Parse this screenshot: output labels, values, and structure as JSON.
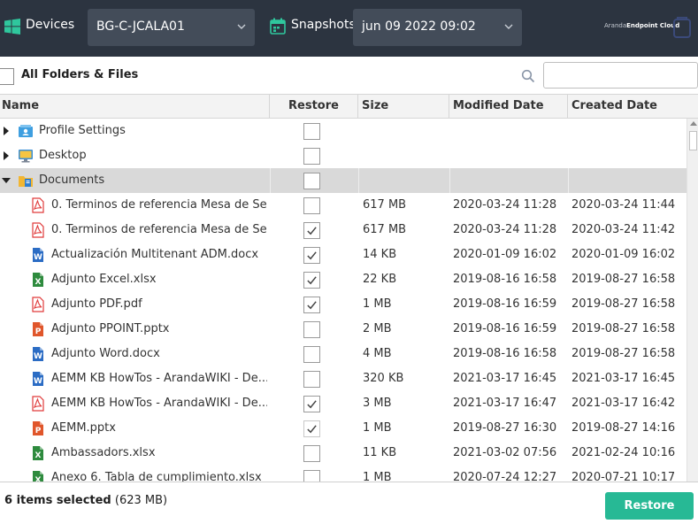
{
  "topbar": {
    "devices_label": "Devices",
    "device_value": "BG-C-JCALA01",
    "snapshots_label": "Snapshots",
    "snapshot_value": "jun 09 2022 09:02",
    "brand_prefix": "Aranda",
    "brand_name": "Endpoint Cloud"
  },
  "toolbar": {
    "all_label": "All Folders & Files",
    "search_value": ""
  },
  "table": {
    "columns": [
      "Name",
      "Restore",
      "Size",
      "Modified Date",
      "Created Date"
    ],
    "rows": [
      {
        "name": "Profile Settings",
        "icon": "profile-icon",
        "type": "folder",
        "expanded": false,
        "selected": false,
        "restore": false,
        "size": "",
        "modified": "",
        "created": ""
      },
      {
        "name": "Desktop",
        "icon": "desktop-icon",
        "type": "folder",
        "expanded": false,
        "selected": false,
        "restore": false,
        "size": "",
        "modified": "",
        "created": ""
      },
      {
        "name": "Documents",
        "icon": "documents-folder-icon",
        "type": "folder",
        "expanded": true,
        "selected": true,
        "restore": false,
        "size": "",
        "modified": "",
        "created": ""
      },
      {
        "name": "0. Terminos de referencia Mesa de Se...",
        "icon": "pdf-icon",
        "type": "file",
        "restore": false,
        "size": "617 MB",
        "modified": "2020-03-24 11:28",
        "created": "2020-03-24 11:44"
      },
      {
        "name": "0. Terminos de referencia Mesa de Se...",
        "icon": "pdf-icon",
        "type": "file",
        "restore": true,
        "size": "617 MB",
        "modified": "2020-03-24 11:28",
        "created": "2020-03-24 11:42"
      },
      {
        "name": "Actualización Multitenant ADM.docx",
        "icon": "word-icon",
        "type": "file",
        "restore": true,
        "size": "14 KB",
        "modified": "2020-01-09 16:02",
        "created": "2020-01-09 16:02"
      },
      {
        "name": "Adjunto Excel.xlsx",
        "icon": "excel-icon",
        "type": "file",
        "restore": true,
        "size": "22 KB",
        "modified": "2019-08-16 16:58",
        "created": "2019-08-27 16:58"
      },
      {
        "name": "Adjunto PDF.pdf",
        "icon": "pdf-icon",
        "type": "file",
        "restore": true,
        "size": "1 MB",
        "modified": "2019-08-16 16:59",
        "created": "2019-08-27 16:58"
      },
      {
        "name": "Adjunto PPOINT.pptx",
        "icon": "powerpoint-icon",
        "type": "file",
        "restore": false,
        "size": "2 MB",
        "modified": "2019-08-16 16:59",
        "created": "2019-08-27 16:58"
      },
      {
        "name": "Adjunto Word.docx",
        "icon": "word-icon",
        "type": "file",
        "restore": false,
        "size": "4 MB",
        "modified": "2019-08-16 16:58",
        "created": "2019-08-27 16:58"
      },
      {
        "name": "AEMM KB HowTos - ArandaWIKI - De...",
        "icon": "word-icon",
        "type": "file",
        "restore": false,
        "size": "320 KB",
        "modified": "2021-03-17 16:45",
        "created": "2021-03-17 16:45"
      },
      {
        "name": "AEMM KB HowTos - ArandaWIKI - De...",
        "icon": "pdf-icon",
        "type": "file",
        "restore": true,
        "size": "3 MB",
        "modified": "2021-03-17 16:47",
        "created": "2021-03-17 16:42"
      },
      {
        "name": "AEMM.pptx",
        "icon": "powerpoint-icon",
        "type": "file",
        "restore": true,
        "restore_light": true,
        "size": "1 MB",
        "modified": "2019-08-27 16:30",
        "created": "2019-08-27 14:16"
      },
      {
        "name": "Ambassadors.xlsx",
        "icon": "excel-icon",
        "type": "file",
        "restore": false,
        "size": "11 KB",
        "modified": "2021-03-02 07:56",
        "created": "2021-02-24 10:16"
      },
      {
        "name": "Anexo 6. Tabla de cumplimiento.xlsx",
        "icon": "excel-icon",
        "type": "file",
        "restore": false,
        "size": "1 MB",
        "modified": "2020-07-24 12:27",
        "created": "2020-07-21 10:17"
      }
    ]
  },
  "footer": {
    "selected_count": "6 items selected",
    "selected_size": "(623 MB)",
    "restore_label": "Restore"
  },
  "colors": {
    "topbar_bg": "#2c3440",
    "select_bg": "#434c59",
    "accent_green": "#27b995",
    "row_selected": "#d9d9d9",
    "pdf_red": "#e03a3a",
    "word_blue": "#2b6cc4",
    "excel_green": "#2e8b3e",
    "ppt_orange": "#e0562b"
  }
}
